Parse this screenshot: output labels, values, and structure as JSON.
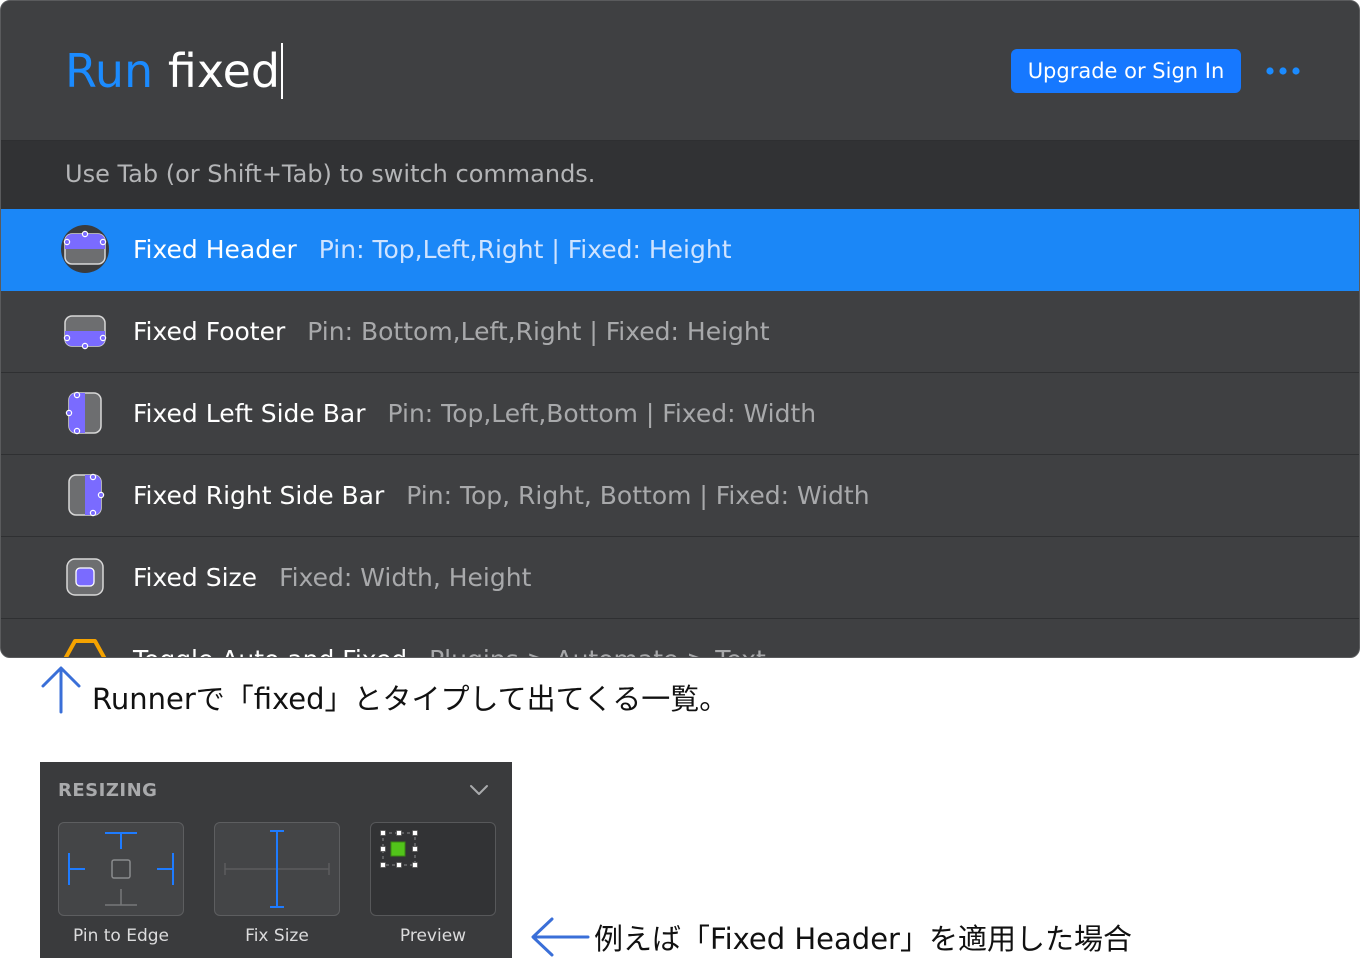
{
  "runner": {
    "query_command": "Run",
    "query_term": "fixed",
    "upgrade_label": "Upgrade or Sign In",
    "hint": "Use Tab (or Shift+Tab) to switch commands.",
    "results": [
      {
        "title": "Fixed Header",
        "detail": "Pin: Top,Left,Right | Fixed: Height",
        "icon": "fixed-header-icon",
        "selected": true
      },
      {
        "title": "Fixed Footer",
        "detail": "Pin: Bottom,Left,Right | Fixed: Height",
        "icon": "fixed-footer-icon",
        "selected": false
      },
      {
        "title": "Fixed Left Side Bar",
        "detail": "Pin: Top,Left,Bottom | Fixed: Width",
        "icon": "fixed-left-sidebar-icon",
        "selected": false
      },
      {
        "title": "Fixed Right Side Bar",
        "detail": "Pin: Top, Right, Bottom | Fixed: Width",
        "icon": "fixed-right-sidebar-icon",
        "selected": false
      },
      {
        "title": "Fixed Size",
        "detail": "Fixed: Width, Height",
        "icon": "fixed-size-icon",
        "selected": false
      },
      {
        "title": "Toggle Auto and Fixed",
        "detail": "Plugins > Automate > Text",
        "icon": "plugin-hexagon-icon",
        "selected": false
      }
    ],
    "colors": {
      "accent": "#1678ff",
      "selection": "#1b87f7",
      "icon_fill": "#7a6bff",
      "plugin": "#f5a300"
    }
  },
  "caption_runner": "Runnerで「fixed」とタイプして出てくる一覧。",
  "resizing_panel": {
    "title": "RESIZING",
    "tiles": [
      {
        "label": "Pin to Edge"
      },
      {
        "label": "Fix Size"
      },
      {
        "label": "Preview"
      }
    ],
    "colors": {
      "guide": "#1e7bff",
      "preview_fill": "#52c41a"
    }
  },
  "caption_panel": "例えば「Fixed Header」を適用した場合"
}
